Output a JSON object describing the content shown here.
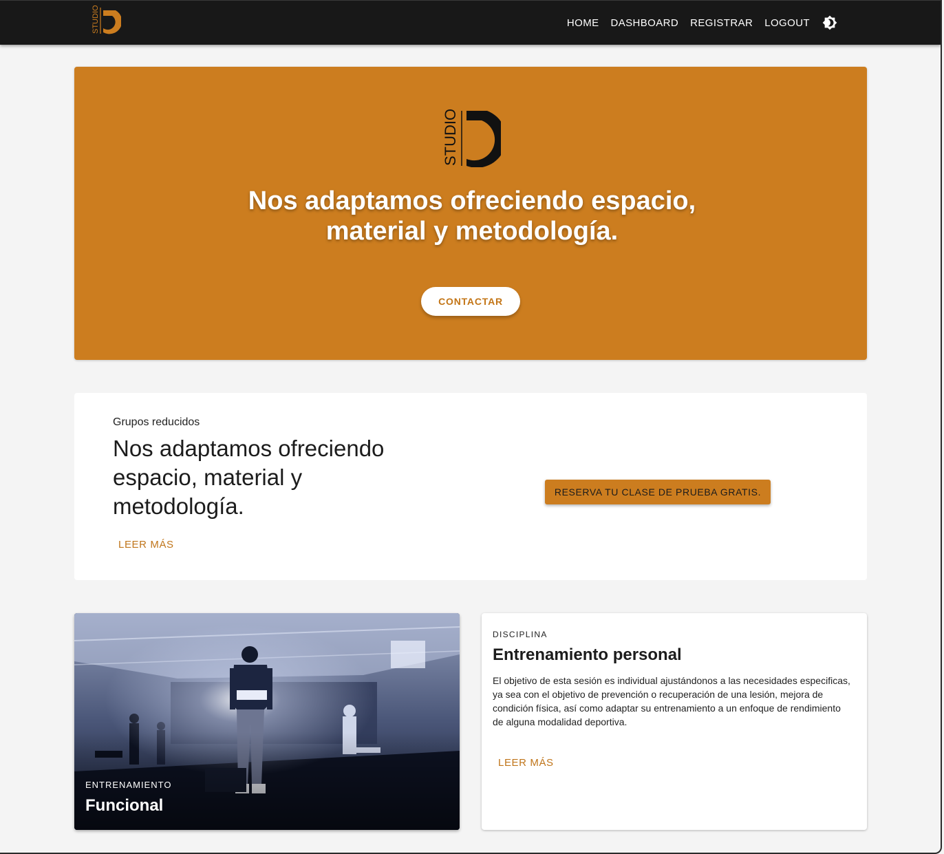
{
  "colors": {
    "brand": "#cc7d1f",
    "appbar": "#181818",
    "background": "#f4f4f4"
  },
  "appbar": {
    "logo": {
      "text": "STUDIO",
      "icon": "studio-g-logo"
    },
    "nav": [
      {
        "label": "HOME"
      },
      {
        "label": "DASHBOARD"
      },
      {
        "label": "REGISTRAR"
      },
      {
        "label": "LOGOUT"
      }
    ],
    "theme_toggle_icon": "brightness-icon"
  },
  "hero": {
    "logo_text": "STUDIO",
    "title_line1": "Nos adaptamos ofreciendo espacio,",
    "title_line2": "material y metodología.",
    "button_label": "CONTACTAR"
  },
  "groups": {
    "overline": "Grupos reducidos",
    "heading": "Nos adaptamos ofreciendo espacio, material y metodología.",
    "more_label": "LEER MÁS",
    "trial_button_label": "RESERVA TU CLASE DE PRUEBA GRATIS."
  },
  "cards": {
    "image_card": {
      "overline": "ENTRENAMIENTO",
      "title": "Funcional"
    },
    "text_card": {
      "overline": "DISCIPLINA",
      "title": "Entrenamiento personal",
      "body": "El objetivo de esta sesión es individual ajustándonos a las necesidades especificas, ya sea con el objetivo de prevención o recuperación de una lesión, mejora de condición física, así como adaptar su entrenamiento a un enfoque de rendimiento de alguna modalidad deportiva.",
      "more_label": "LEER MÁS"
    }
  }
}
